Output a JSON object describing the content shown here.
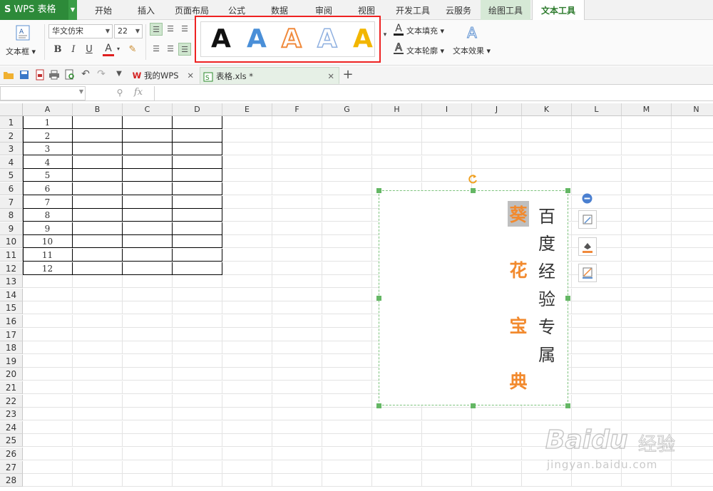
{
  "app": {
    "logo_letter": "S",
    "name": "WPS 表格"
  },
  "menu_tabs": [
    "开始",
    "插入",
    "页面布局",
    "公式",
    "数据",
    "审阅",
    "视图",
    "开发工具",
    "云服务",
    "绘图工具",
    "文本工具"
  ],
  "ribbon": {
    "textbox_label": "文本框",
    "font_name": "华文仿宋",
    "font_size": "22",
    "bold": "B",
    "italic": "I",
    "underline": "U",
    "font_color": "A",
    "style_letter": "A",
    "text_fill": "文本填充",
    "text_outline": "文本轮廓",
    "text_effect": "文本效果",
    "colors": {
      "black": "#111111",
      "blue": "#4a8fd8",
      "orange": "#f08a3c",
      "light_blue": "#a7c0e8",
      "gold": "#f2b600"
    }
  },
  "doc_tabs": [
    {
      "label": "我的WPS",
      "active": false
    },
    {
      "label": "表格.xls *",
      "active": true
    }
  ],
  "formula": {
    "fx": "fx"
  },
  "columns": [
    "A",
    "B",
    "C",
    "D",
    "E",
    "F",
    "G",
    "H",
    "I",
    "J",
    "K",
    "L",
    "M",
    "N"
  ],
  "rows": [
    "1",
    "2",
    "3",
    "4",
    "5",
    "6",
    "7",
    "8",
    "9",
    "10",
    "11",
    "12",
    "13",
    "14",
    "15",
    "16",
    "17",
    "18",
    "19",
    "20",
    "21",
    "22",
    "23",
    "24",
    "25",
    "26",
    "27",
    "28"
  ],
  "col_a_values": [
    "1",
    "2",
    "3",
    "4",
    "5",
    "6",
    "7",
    "8",
    "9",
    "10",
    "11",
    "12"
  ],
  "textbox": {
    "orange_text": [
      "葵",
      "花",
      "宝",
      "典"
    ],
    "black_text": [
      "百",
      "度",
      "经",
      "验",
      "专",
      "属"
    ]
  },
  "watermark": {
    "brand": "Baidu",
    "brand_cn": "经验",
    "url": "jingyan.baidu.com"
  }
}
